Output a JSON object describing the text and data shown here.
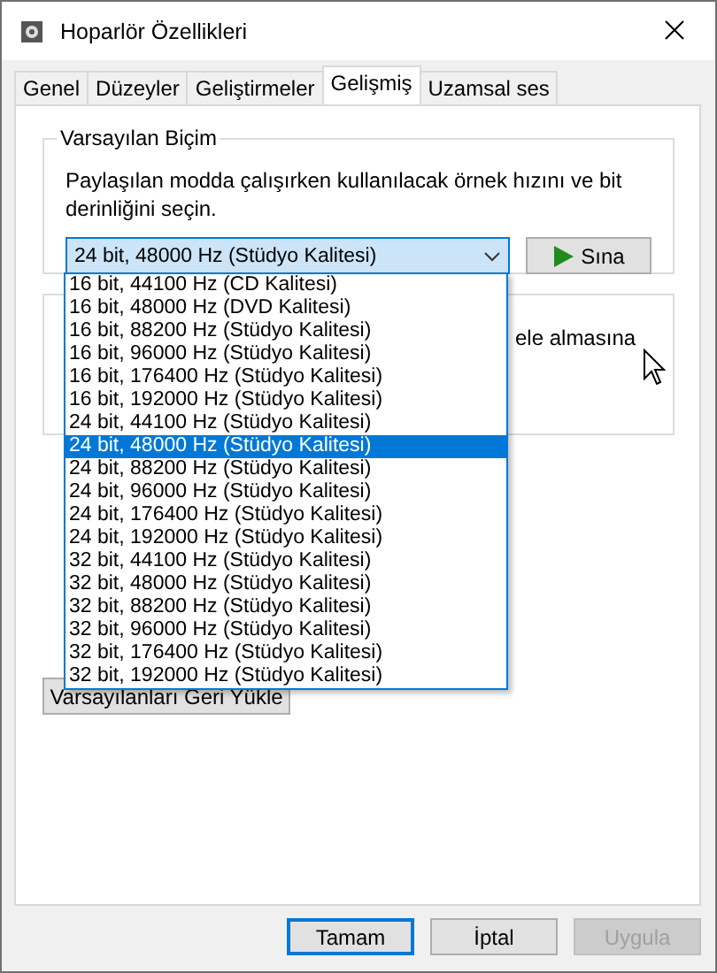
{
  "window": {
    "title": "Hoparlör Özellikleri"
  },
  "tabs": [
    {
      "label": "Genel",
      "selected": false
    },
    {
      "label": "Düzeyler",
      "selected": false
    },
    {
      "label": "Geliştirmeler",
      "selected": false
    },
    {
      "label": "Gelişmiş",
      "selected": true
    },
    {
      "label": "Uzamsal ses",
      "selected": false
    }
  ],
  "default_format": {
    "title": "Varsayılan Biçim",
    "description": "Paylaşılan modda çalışırken kullanılacak örnek hızını ve bit derinliğini seçin.",
    "combo_value": "24 bit, 48000 Hz (Stüdyo Kalitesi)",
    "test_button": "Sına",
    "options": [
      {
        "label": "16 bit, 44100 Hz (CD Kalitesi)",
        "selected": false
      },
      {
        "label": "16 bit, 48000 Hz (DVD Kalitesi)",
        "selected": false
      },
      {
        "label": "16 bit, 88200 Hz (Stüdyo Kalitesi)",
        "selected": false
      },
      {
        "label": "16 bit, 96000 Hz (Stüdyo Kalitesi)",
        "selected": false
      },
      {
        "label": "16 bit, 176400 Hz (Stüdyo Kalitesi)",
        "selected": false
      },
      {
        "label": "16 bit, 192000 Hz (Stüdyo Kalitesi)",
        "selected": false
      },
      {
        "label": "24 bit, 44100 Hz (Stüdyo Kalitesi)",
        "selected": false
      },
      {
        "label": "24 bit, 48000 Hz (Stüdyo Kalitesi)",
        "selected": true
      },
      {
        "label": "24 bit, 88200 Hz (Stüdyo Kalitesi)",
        "selected": false
      },
      {
        "label": "24 bit, 96000 Hz (Stüdyo Kalitesi)",
        "selected": false
      },
      {
        "label": "24 bit, 176400 Hz (Stüdyo Kalitesi)",
        "selected": false
      },
      {
        "label": "24 bit, 192000 Hz (Stüdyo Kalitesi)",
        "selected": false
      },
      {
        "label": "32 bit, 44100 Hz (Stüdyo Kalitesi)",
        "selected": false
      },
      {
        "label": "32 bit, 48000 Hz (Stüdyo Kalitesi)",
        "selected": false
      },
      {
        "label": "32 bit, 88200 Hz (Stüdyo Kalitesi)",
        "selected": false
      },
      {
        "label": "32 bit, 96000 Hz (Stüdyo Kalitesi)",
        "selected": false
      },
      {
        "label": "32 bit, 176400 Hz (Stüdyo Kalitesi)",
        "selected": false
      },
      {
        "label": "32 bit, 192000 Hz (Stüdyo Kalitesi)",
        "selected": false
      }
    ]
  },
  "exclusive_mode": {
    "partial_text": "ele almasına"
  },
  "restore_button": "Varsayılanları Geri Yükle",
  "buttons": [
    {
      "label": "Tamam",
      "focused": true,
      "disabled": false
    },
    {
      "label": "İptal",
      "focused": false,
      "disabled": false
    },
    {
      "label": "Uygula",
      "focused": false,
      "disabled": true
    }
  ]
}
